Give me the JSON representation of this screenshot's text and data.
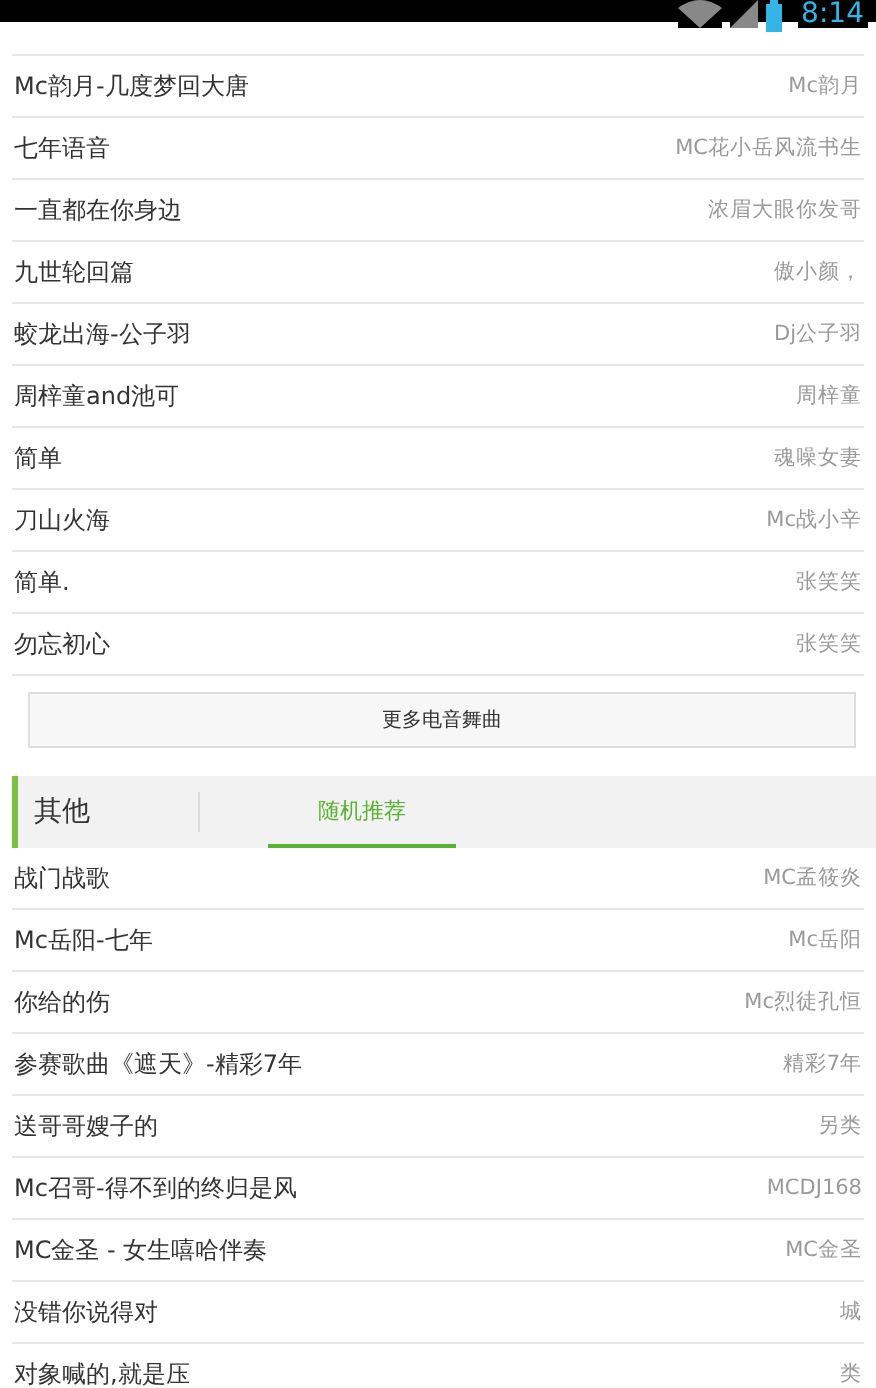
{
  "status_bar": {
    "time": "8:14"
  },
  "top_list": [
    {
      "title": "Mc韵月-几度梦回大唐",
      "artist": "Mc韵月"
    },
    {
      "title": "七年语音",
      "artist": "MC花小岳风流书生"
    },
    {
      "title": "一直都在你身边",
      "artist": "浓眉大眼你发哥"
    },
    {
      "title": "九世轮回篇",
      "artist": "傲小颜，"
    },
    {
      "title": "蛟龙出海-公子羽",
      "artist": "Dj公子羽"
    },
    {
      "title": "周梓童and池可",
      "artist": "周梓童"
    },
    {
      "title": "简单",
      "artist": "魂噪女妻"
    },
    {
      "title": "刀山火海",
      "artist": "Mc战小辛"
    },
    {
      "title": "简单.",
      "artist": "张笑笑"
    },
    {
      "title": "勿忘初心",
      "artist": "张笑笑"
    }
  ],
  "more_button": "更多电音舞曲",
  "section": {
    "title": "其他",
    "tabs": [
      {
        "label": "随机推荐",
        "selected": true
      }
    ]
  },
  "bottom_list": [
    {
      "title": "战门战歌",
      "artist": "MC孟筱炎"
    },
    {
      "title": "Mc岳阳-七年",
      "artist": "Mc岳阳"
    },
    {
      "title": "你给的伤",
      "artist": "Mc烈徒孔恒"
    },
    {
      "title": "参赛歌曲《遮天》-精彩7年",
      "artist": "精彩7年"
    },
    {
      "title": "送哥哥嫂子的",
      "artist": "另类"
    },
    {
      "title": "Mc召哥-得不到的终归是风",
      "artist": "MCDJ168"
    },
    {
      "title": "MC金圣 - 女生嘻哈伴奏",
      "artist": "MC金圣"
    },
    {
      "title": "没错你说得对",
      "artist": "城"
    },
    {
      "title": "对象喊的,就是压",
      "artist": "类"
    }
  ]
}
